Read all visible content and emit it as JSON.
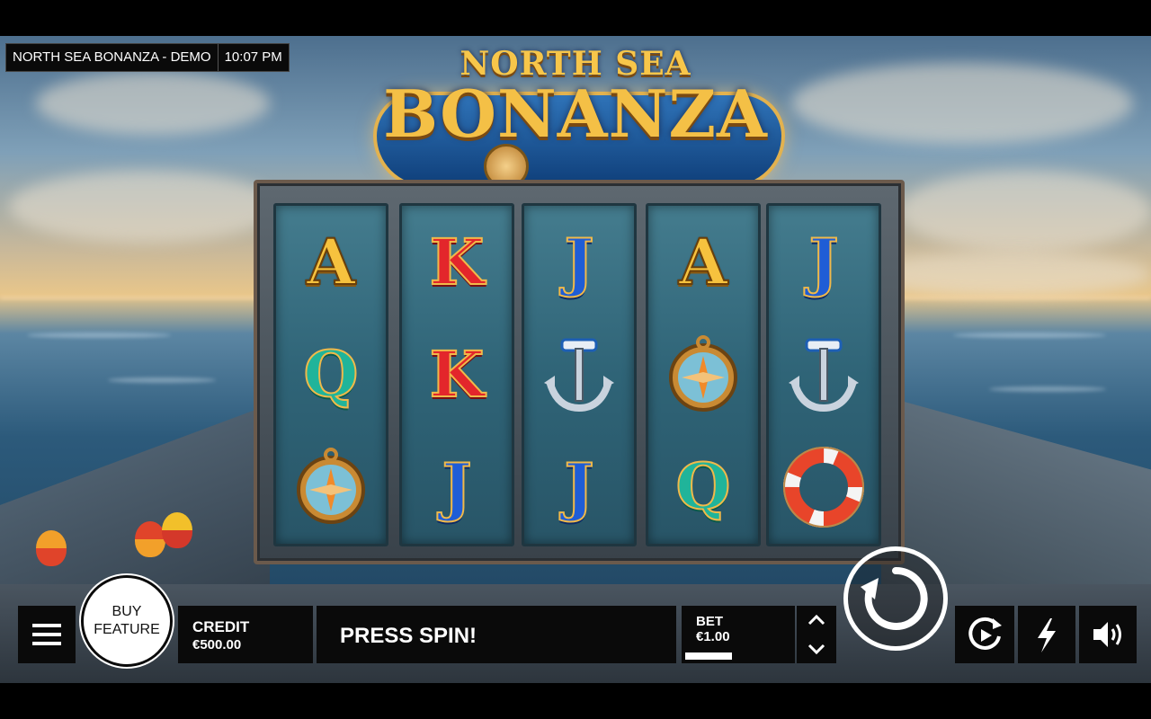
{
  "hud": {
    "game_title": "NORTH SEA BONANZA - DEMO",
    "time": "10:07 PM"
  },
  "logo": {
    "line1": "NORTH SEA",
    "line2": "BONANZA"
  },
  "reels": [
    [
      "A",
      "Q",
      "compass"
    ],
    [
      "K",
      "K",
      "J"
    ],
    [
      "J",
      "anchor",
      "J"
    ],
    [
      "A",
      "compass",
      "Q"
    ],
    [
      "J",
      "anchor",
      "lifebuoy"
    ]
  ],
  "controls": {
    "buy_feature_line1": "BUY",
    "buy_feature_line2": "FEATURE",
    "credit_label": "CREDIT",
    "credit_value": "€500.00",
    "message": "PRESS SPIN!",
    "bet_label": "BET",
    "bet_value": "€1.00"
  },
  "icons": {
    "menu": "menu-icon",
    "spin": "spin-icon",
    "autoplay": "autoplay-icon",
    "turbo": "lightning-icon",
    "sound": "speaker-icon",
    "bet_up": "chevron-up-icon",
    "bet_down": "chevron-down-icon"
  },
  "colors": {
    "bar_bg": "#0a0a0a",
    "text": "#ffffff",
    "accent_gold": "#f4c046"
  }
}
